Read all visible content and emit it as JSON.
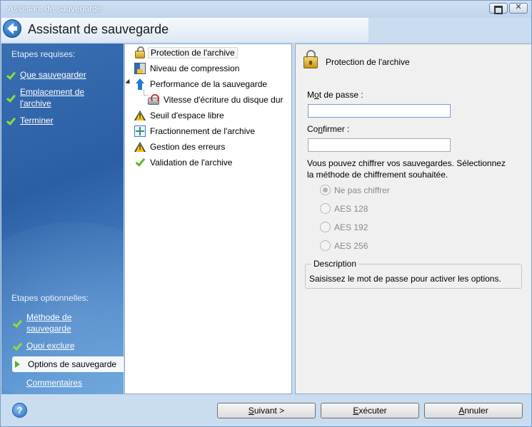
{
  "window": {
    "title": "Assistant de sauvegarde",
    "header_title": "Assistant de sauvegarde"
  },
  "steps": {
    "required_title": "Etapes requises:",
    "required": [
      {
        "label": "Que sauvegarder"
      },
      {
        "label_line1": "Emplacement de",
        "label_line2": "l'archive"
      },
      {
        "label": "Terminer"
      }
    ],
    "optional_title": "Etapes optionnelles:",
    "optional": [
      {
        "label_line1": "Méthode de",
        "label_line2": "sauvegarde"
      },
      {
        "label": "Quoi exclure"
      },
      {
        "label": "Options de sauvegarde",
        "active": true
      },
      {
        "label": "Commentaires"
      }
    ]
  },
  "tree": {
    "items": [
      {
        "label": "Protection de l'archive",
        "icon": "lock-icon",
        "selected": true
      },
      {
        "label": "Niveau de compression",
        "icon": "compression-icon"
      },
      {
        "label": "Performance de la sauvegarde",
        "icon": "arrow-up-icon"
      },
      {
        "label": "Vitesse d'écriture du disque dur",
        "icon": "disk-icon"
      },
      {
        "label": "Seuil d'espace libre",
        "icon": "warning-icon"
      },
      {
        "label": "Fractionnement de l'archive",
        "icon": "split-icon"
      },
      {
        "label": "Gestion des erreurs",
        "icon": "warning-icon"
      },
      {
        "label": "Validation de l'archive",
        "icon": "check-icon"
      }
    ]
  },
  "details": {
    "title": "Protection de l'archive",
    "password_label_prefix": "M",
    "password_label_access": "o",
    "password_label_rest": "t de passe :",
    "password_value": "",
    "confirm_label_prefix": "Co",
    "confirm_label_access": "n",
    "confirm_label_rest": "firmer :",
    "confirm_value": "",
    "info_line1": "Vous pouvez chiffrer vos sauvegardes. Sélectionnez",
    "info_line2": "la méthode de chiffrement souhaitée.",
    "options": [
      {
        "label": "Ne pas chiffrer",
        "checked": true
      },
      {
        "label": "AES 128"
      },
      {
        "label": "AES 192"
      },
      {
        "label": "AES 256"
      }
    ],
    "description_title": "Description",
    "description_text": "Saisissez le mot de passe pour activer les options."
  },
  "footer": {
    "help": "?",
    "next_access": "S",
    "next_rest": "uivant >",
    "run_access": "E",
    "run_rest": "xécuter",
    "cancel_access": "A",
    "cancel_rest": "nnuler"
  }
}
